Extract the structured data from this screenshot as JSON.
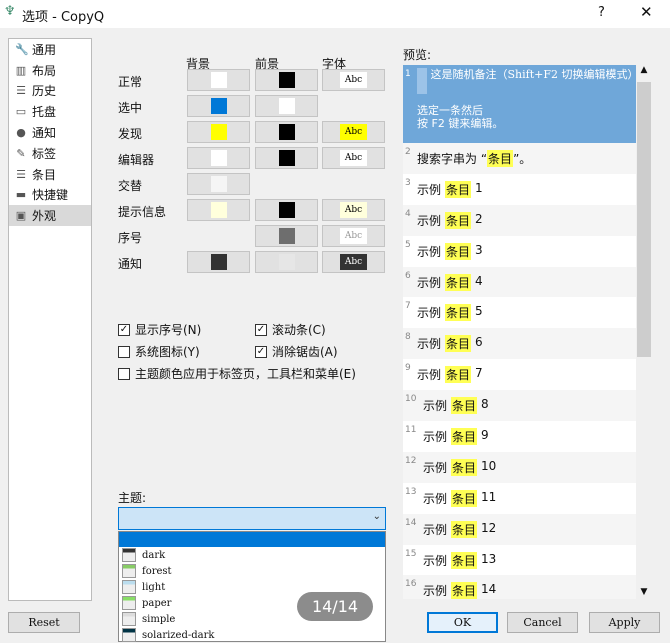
{
  "window": {
    "title": "选项 - CopyQ",
    "help": "?",
    "close": "✕"
  },
  "sidebar": {
    "items": [
      {
        "label": "通用",
        "icon": "🔧"
      },
      {
        "label": "布局",
        "icon": "▥"
      },
      {
        "label": "历史",
        "icon": "☰"
      },
      {
        "label": "托盘",
        "icon": "▭"
      },
      {
        "label": "通知",
        "icon": "●"
      },
      {
        "label": "标签",
        "icon": "✎"
      },
      {
        "label": "条目",
        "icon": "☰"
      },
      {
        "label": "快捷键",
        "icon": "▬"
      },
      {
        "label": "外观",
        "icon": "▣",
        "selected": true
      }
    ]
  },
  "colors": {
    "headers": {
      "bg": "背景",
      "fg": "前景",
      "font": "字体"
    },
    "rows": [
      {
        "label": "正常",
        "bg": "#ffffff",
        "fg": "#000000",
        "font": {
          "text": "Abc",
          "bg": "#ffffff",
          "color": "#000000"
        }
      },
      {
        "label": "选中",
        "bg": "#0078d7",
        "fg": "#ffffff",
        "font": null
      },
      {
        "label": "发现",
        "bg": "#ffff00",
        "fg": "#000000",
        "font": {
          "text": "Abc",
          "bg": "#ffff00",
          "color": "#000000"
        }
      },
      {
        "label": "编辑器",
        "bg": "#ffffff",
        "fg": "#000000",
        "font": {
          "text": "Abc",
          "bg": "#ffffff",
          "color": "#000000"
        }
      },
      {
        "label": "交替",
        "bg": "#f5f5f5",
        "fg": null,
        "font": null
      },
      {
        "label": "提示信息",
        "bg": "#ffffdc",
        "fg": "#000000",
        "font": {
          "text": "Abc",
          "bg": "#ffffdc",
          "color": "#000000"
        }
      },
      {
        "label": "序号",
        "bg": null,
        "fg": "#6e6e6e",
        "font": {
          "text": "Abc",
          "bg": "#ffffff",
          "color": "#999999"
        }
      },
      {
        "label": "通知",
        "bg": "#333333",
        "fg": "#e6e6e6",
        "font": {
          "text": "Abc",
          "bg": "#333333",
          "color": "#ffffff"
        }
      }
    ]
  },
  "options": [
    {
      "label": "显示序号(N)",
      "checked": true
    },
    {
      "label": "滚动条(C)",
      "checked": true
    },
    {
      "label": "系统图标(Y)",
      "checked": false
    },
    {
      "label": "消除锯齿(A)",
      "checked": true
    },
    {
      "label": "主题颜色应用于标签页，工具栏和菜单(E)",
      "checked": false
    }
  ],
  "theme": {
    "label": "主题:",
    "value": "",
    "options": [
      "dark",
      "forest",
      "light",
      "paper",
      "simple",
      "solarized-dark"
    ]
  },
  "preview": {
    "label": "预览:",
    "selected": {
      "num": "1",
      "note": "这是随机备注（Shift+F2 切换编辑模式）",
      "text1": "选定一条然后",
      "text2": "按 F2 键来编辑。"
    },
    "search": {
      "num": "2",
      "pre": "搜索字串为 “",
      "hl": "条目",
      "post": "”。"
    },
    "items": [
      {
        "num": "3",
        "n": "1"
      },
      {
        "num": "4",
        "n": "2"
      },
      {
        "num": "5",
        "n": "3"
      },
      {
        "num": "6",
        "n": "4"
      },
      {
        "num": "7",
        "n": "5"
      },
      {
        "num": "8",
        "n": "6"
      },
      {
        "num": "9",
        "n": "7"
      },
      {
        "num": "10",
        "n": "8"
      },
      {
        "num": "11",
        "n": "9"
      },
      {
        "num": "12",
        "n": "10"
      },
      {
        "num": "13",
        "n": "11"
      },
      {
        "num": "14",
        "n": "12"
      },
      {
        "num": "15",
        "n": "13"
      },
      {
        "num": "16",
        "n": "14"
      }
    ],
    "item_prefix": "示例",
    "item_hl": "条目"
  },
  "buttons": {
    "reset": "Reset",
    "ok": "OK",
    "cancel": "Cancel",
    "apply": "Apply"
  },
  "overlay": "14/14"
}
